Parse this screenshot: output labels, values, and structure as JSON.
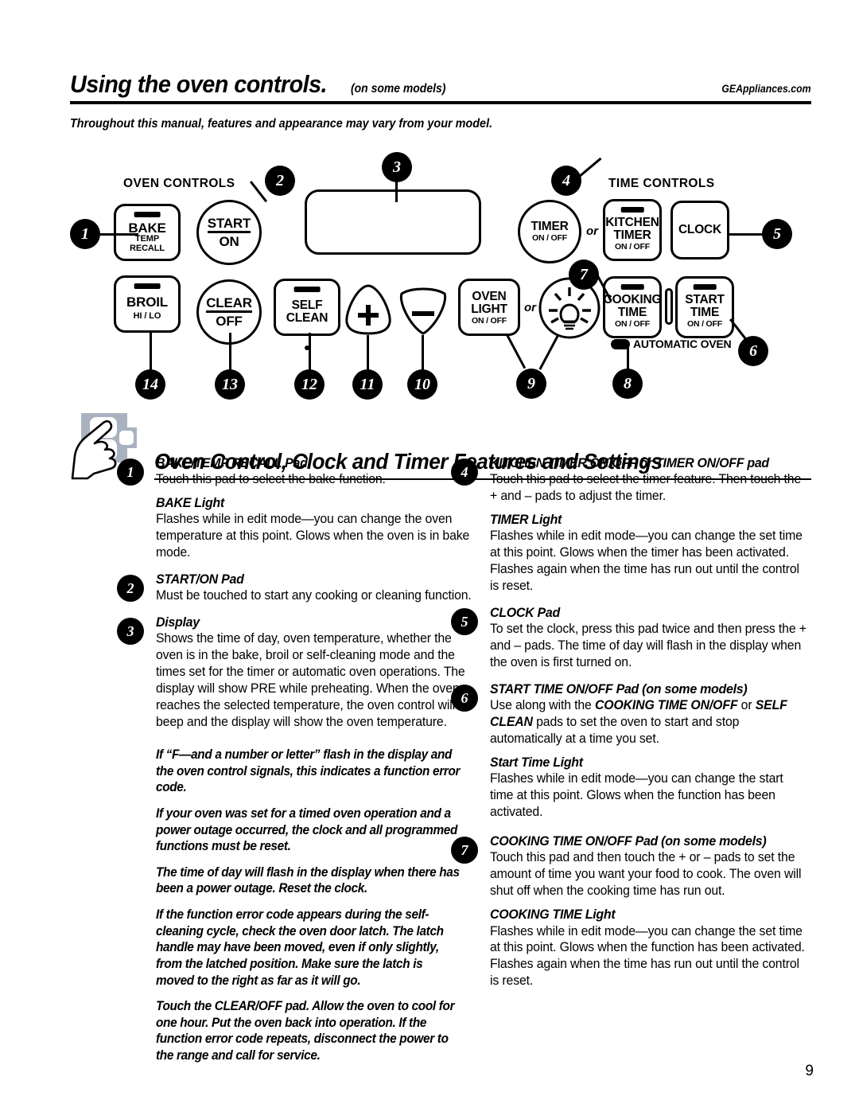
{
  "header": {
    "title": "Using the oven controls.",
    "subtitle": "(on some models)",
    "site": "GEAppliances.com",
    "note": "Throughout this manual, features and appearance may vary from your model."
  },
  "panel": {
    "oven_controls_label": "OVEN CONTROLS",
    "time_controls_label": "TIME CONTROLS",
    "automatic_oven_label": "AUTOMATIC OVEN",
    "or_label": "or",
    "keys": {
      "bake": {
        "main": "BAKE",
        "sub": "TEMP\nRECALL"
      },
      "start_on": {
        "line1": "START",
        "line2": "ON"
      },
      "broil": {
        "main": "BROIL",
        "sub": "HI / LO"
      },
      "clear_off": {
        "line1": "CLEAR",
        "line2": "OFF"
      },
      "self_clean": {
        "line1": "SELF",
        "line2": "CLEAN"
      },
      "plus": "+",
      "minus": "–",
      "oven_light": {
        "line1": "OVEN",
        "line2": "LIGHT",
        "onoff": "ON / OFF"
      },
      "timer": {
        "main": "TIMER",
        "onoff": "ON / OFF"
      },
      "kitchen_timer": {
        "line1": "KITCHEN",
        "line2": "TIMER",
        "onoff": "ON / OFF"
      },
      "clock": {
        "main": "CLOCK"
      },
      "cooking_time": {
        "line1": "COOKING",
        "line2": "TIME",
        "onoff": "ON / OFF"
      },
      "start_time": {
        "line1": "START",
        "line2": "TIME",
        "onoff": "ON / OFF"
      }
    },
    "callouts": {
      "c1": "1",
      "c2": "2",
      "c3": "3",
      "c4": "4",
      "c5": "5",
      "c6": "6",
      "c7": "7",
      "c8": "8",
      "c9": "9",
      "c10": "10",
      "c11": "11",
      "c12": "12",
      "c13": "13",
      "c14": "14"
    }
  },
  "section": {
    "title": "Oven Control, Clock and Timer Features and Settings"
  },
  "left_column": {
    "e1": {
      "num": "1",
      "title": "BAKE/TEMP RECALL Pad",
      "body": "Touch this pad to select the bake function.",
      "sub_head": "BAKE Light",
      "sub_body": "Flashes while in edit mode—you can change the oven temperature at this point. Glows when the oven is in bake mode."
    },
    "e2": {
      "num": "2",
      "title": "START/ON Pad",
      "body": "Must be touched to start any cooking or cleaning function."
    },
    "e3": {
      "num": "3",
      "title": "Display",
      "body": "Shows the time of day, oven temperature, whether the oven is in the bake, broil or self-cleaning mode and the times set for the timer or automatic oven operations. The display will show PRE while preheating. When the oven reaches the selected temperature, the oven control will beep and the display will show the oven temperature."
    },
    "notes": [
      "If “F—and a number or letter” flash in the display and the oven control signals, this indicates a function error code.",
      "If your oven was set for a timed oven operation and a power outage occurred, the clock and all programmed functions must be reset.",
      "The time of day will flash in the display when there has been a power outage. Reset the clock.",
      "If the function error code appears during the self-cleaning cycle, check the oven door latch. The latch handle may have been moved, even if only slightly, from the latched position. Make sure the latch is moved to the right as far as it will go.",
      "Touch the CLEAR/OFF pad. Allow the oven to cool for one hour. Put the oven back into operation. If the function error code repeats, disconnect the power to the range and call for service."
    ]
  },
  "right_column": {
    "e4": {
      "num": "4",
      "title": "KITCHEN TIMER ON/OFF or TIMER ON/OFF pad",
      "body": "Touch this pad to select the timer feature. Then touch the + and – pads to adjust the timer.",
      "sub_head": "TIMER Light",
      "sub_body": "Flashes while in edit mode—you can change the set time at this point. Glows when the timer has been activated. Flashes again when the time has run out until the control is reset."
    },
    "e5": {
      "num": "5",
      "title": "CLOCK Pad",
      "body": "To set the clock, press this pad twice and then press the + and – pads. The time of day will flash in the display when the oven is first turned on."
    },
    "e6": {
      "num": "6",
      "title": "START TIME ON/OFF Pad (on some models)",
      "body_pre": "Use along with the ",
      "body_em1": "COOKING TIME ON/OFF",
      "body_mid": " or ",
      "body_em2": "SELF CLEAN",
      "body_post": " pads to set the oven to start and stop automatically at a time you set.",
      "sub_head": "Start Time Light",
      "sub_body": "Flashes while in edit mode—you can change the start time at this point. Glows when the function has been activated."
    },
    "e7": {
      "num": "7",
      "title": "COOKING TIME ON/OFF Pad (on some models)",
      "body": "Touch this pad and then touch the + or – pads to set the amount of time you want your food to cook. The oven will shut off when the cooking time has run out.",
      "sub_head": "COOKING TIME Light",
      "sub_body": "Flashes while in edit mode—you can change the set time at this point. Glows when the function has been activated. Flashes again when the time has run out until the control is reset."
    }
  },
  "page_number": "9"
}
